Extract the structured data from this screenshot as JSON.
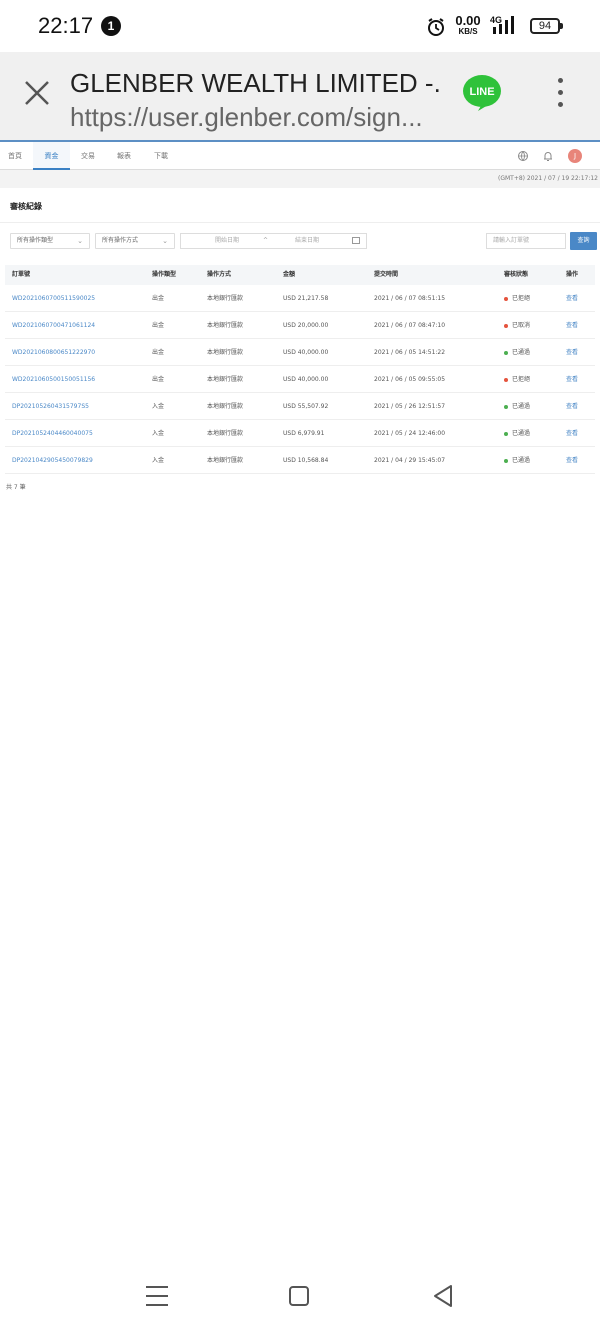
{
  "status_bar": {
    "time": "22:17",
    "notification_count": "1",
    "speed_value": "0.00",
    "speed_unit": "KB/S",
    "network": "4G",
    "battery": "94"
  },
  "browser": {
    "title": "GLENBER WEALTH LIMITED -...",
    "url": "https://user.glenber.com/sign...",
    "line_label": "LINE"
  },
  "nav": {
    "tabs": [
      {
        "label": "首頁"
      },
      {
        "label": "資金"
      },
      {
        "label": "交易"
      },
      {
        "label": "報表"
      },
      {
        "label": "下載"
      }
    ],
    "active_tab": "資金",
    "avatar_initial": "J"
  },
  "datetime": "(GMT+8) 2021 / 07 / 19 22:17:12",
  "section_title": "審核紀錄",
  "filters": {
    "operation_type": "所有操作類型",
    "operation_method": "所有操作方式",
    "start_date_placeholder": "開始日期",
    "end_date_placeholder": "結束日期",
    "order_placeholder": "請輸入訂單號",
    "query_button": "查詢"
  },
  "table": {
    "headers": [
      "訂單號",
      "操作類型",
      "操作方式",
      "金額",
      "提交時間",
      "審核狀態",
      "操作"
    ],
    "rows": [
      {
        "order": "WD2021060700511590025",
        "type": "出金",
        "method": "本地銀行匯款",
        "amount": "USD 21,217.58",
        "time": "2021 / 06 / 07 08:51:15",
        "status": "已拒絕",
        "status_color": "#e5533d",
        "action": "查看"
      },
      {
        "order": "WD2021060700471061124",
        "type": "出金",
        "method": "本地銀行匯款",
        "amount": "USD 20,000.00",
        "time": "2021 / 06 / 07 08:47:10",
        "status": "已取消",
        "status_color": "#e5533d",
        "action": "查看"
      },
      {
        "order": "WD2021060800651222970",
        "type": "出金",
        "method": "本地銀行匯款",
        "amount": "USD 40,000.00",
        "time": "2021 / 06 / 05 14:51:22",
        "status": "已通過",
        "status_color": "#4caf50",
        "action": "查看"
      },
      {
        "order": "WD2021060500150051156",
        "type": "出金",
        "method": "本地銀行匯款",
        "amount": "USD 40,000.00",
        "time": "2021 / 06 / 05 09:55:05",
        "status": "已拒絕",
        "status_color": "#e5533d",
        "action": "查看"
      },
      {
        "order": "DP2021052604315797S5",
        "type": "入金",
        "method": "本地銀行匯款",
        "amount": "USD 55,507.92",
        "time": "2021 / 05 / 26 12:51:57",
        "status": "已通過",
        "status_color": "#4caf50",
        "action": "查看"
      },
      {
        "order": "DP2021052404460040075",
        "type": "入金",
        "method": "本地銀行匯款",
        "amount": "USD 6,979.91",
        "time": "2021 / 05 / 24 12:46:00",
        "status": "已通過",
        "status_color": "#4caf50",
        "action": "查看"
      },
      {
        "order": "DP2021042905450079829",
        "type": "入金",
        "method": "本地銀行匯款",
        "amount": "USD 10,568.84",
        "time": "2021 / 04 / 29 15:45:07",
        "status": "已通過",
        "status_color": "#4caf50",
        "action": "查看"
      }
    ],
    "total": "共 7 筆"
  },
  "colors": {
    "accent": "#3a80c4",
    "line_green": "#2fc23a"
  }
}
